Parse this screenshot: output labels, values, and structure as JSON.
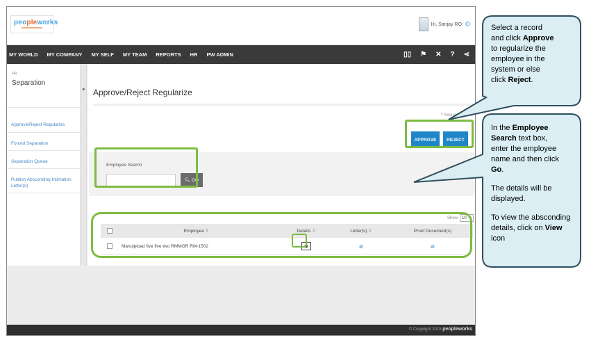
{
  "app": {
    "logo_part1": "peo",
    "logo_part2": "ple",
    "logo_part3": "works",
    "greeting": "Hi, Sanjay RO"
  },
  "nav": {
    "items": [
      "MY WORLD",
      "MY COMPANY",
      "MY SELF",
      "MY TEAM",
      "REPORTS",
      "HR",
      "PW ADMIN"
    ],
    "icons": [
      "book-icon",
      "flag-icon",
      "tools-icon",
      "help-icon",
      "share-icon"
    ]
  },
  "sidebar": {
    "section": "HR",
    "title": "Separation",
    "items": [
      "Approve/Reject Regularize",
      "Forced Separation",
      "Separation Queue",
      "Publish Absconding Intimation Letter(s)"
    ]
  },
  "main": {
    "title": "Approve/Reject Regularize",
    "required_label": "Required fields",
    "approve_label": "APPROVE",
    "reject_label": "REJECT",
    "search": {
      "label": "Employee Search",
      "value": "",
      "placeholder": "",
      "go_label": "GO"
    },
    "show_label": "Show",
    "show_value": "10",
    "table": {
      "headers": [
        "Employee",
        "Details",
        "Letter(s)",
        "Proof Document(s)"
      ],
      "rows": [
        {
          "employee": "Manuipload five five two RMMGR RM-1502"
        }
      ]
    }
  },
  "footer": {
    "copyright": "© Copyright 2015",
    "brand": "peopleworks"
  },
  "callouts": {
    "approve": {
      "l1": "Select a record",
      "l2a": "and click ",
      "l2b": "Approve",
      "l3": "to regularize the",
      "l4": "employee in the",
      "l5": "system or else",
      "l6a": "click ",
      "l6b": "Reject",
      "l6c": "."
    },
    "search": {
      "l1a": "In the ",
      "l1b": "Employee",
      "l2a": "Search",
      "l2b": " text box,",
      "l3": "enter the employee",
      "l4": "name and then click",
      "l5a": "Go",
      "l5b": ".",
      "p2": "The details will be displayed.",
      "p3a": "To view the absconding details, click on ",
      "p3b": "View",
      "p3c": " icon"
    }
  },
  "colors": {
    "navbar": "#3a3a3a",
    "primary_button": "#1f86c8",
    "highlight": "#7dbb42",
    "callout_fill": "#daeef3",
    "callout_border": "#2f4f5f",
    "link": "#3f86c6"
  }
}
